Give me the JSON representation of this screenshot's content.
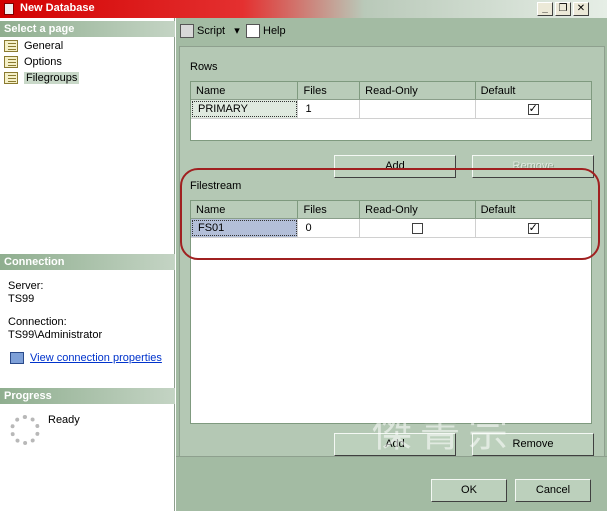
{
  "window": {
    "title": "New Database",
    "buttons": {
      "minimize": "_",
      "restore": "❐",
      "close": "✕"
    }
  },
  "left": {
    "select_header": "Select a page",
    "pages": [
      {
        "label": "General"
      },
      {
        "label": "Options"
      },
      {
        "label": "Filegroups"
      }
    ],
    "connection_header": "Connection",
    "server_label": "Server:",
    "server_value": "TS99",
    "connection_label": "Connection:",
    "connection_value": "TS99\\Administrator",
    "view_props_link": "View connection properties",
    "progress_header": "Progress",
    "progress_status": "Ready"
  },
  "toolbar": {
    "script_label": "Script",
    "help_label": "Help"
  },
  "rows_group": {
    "label": "Rows",
    "headers": [
      "Name",
      "Files",
      "Read-Only",
      "Default"
    ],
    "rows": [
      {
        "name": "PRIMARY",
        "files": "1",
        "read_only": null,
        "default": true
      }
    ],
    "add_label": "Add",
    "remove_label": "Remove"
  },
  "filestream_group": {
    "label": "Filestream",
    "headers": [
      "Name",
      "Files",
      "Read-Only",
      "Default"
    ],
    "rows": [
      {
        "name": "FS01",
        "files": "0",
        "read_only": false,
        "default": true
      }
    ],
    "add_label": "Add",
    "remove_label": "Remove"
  },
  "footer": {
    "ok_label": "OK",
    "cancel_label": "Cancel"
  },
  "colors": {
    "title_bar": "#d20000",
    "pane_bg": "#a3bba3",
    "highlight": "#a02020",
    "link": "#0033cc"
  }
}
